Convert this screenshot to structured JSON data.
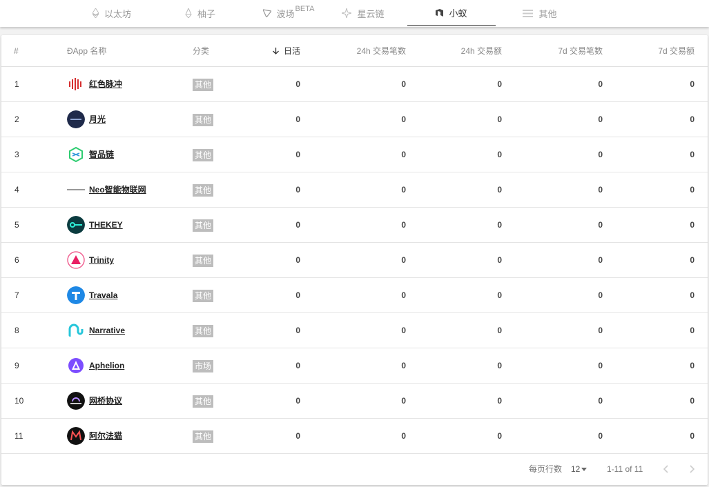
{
  "tabs": [
    {
      "label": "以太坊",
      "icon": "ethereum-icon"
    },
    {
      "label": "柚子",
      "icon": "eos-icon"
    },
    {
      "label": "波场",
      "beta": "BETA",
      "icon": "tron-icon"
    },
    {
      "label": "星云链",
      "icon": "nebulas-icon"
    },
    {
      "label": "小蚁",
      "icon": "neo-icon",
      "active": true
    },
    {
      "label": "其他",
      "icon": "menu-lines-icon"
    }
  ],
  "table": {
    "headers": {
      "rank": "#",
      "name": "ĐApp 名称",
      "category": "分类",
      "dau": "日活",
      "tx24": "24h 交易笔数",
      "vol24": "24h 交易额",
      "tx7d": "7d 交易笔数",
      "vol7d": "7d 交易额"
    },
    "sort_icon": "arrow-down-icon",
    "rows": [
      {
        "rank": "1",
        "name": "红色脉冲",
        "category": "其他",
        "dau": "0",
        "tx24": "0",
        "vol24": "0",
        "tx7d": "0",
        "vol7d": "0",
        "logo": "red-pulse-logo"
      },
      {
        "rank": "2",
        "name": "月光",
        "category": "其他",
        "dau": "0",
        "tx24": "0",
        "vol24": "0",
        "tx7d": "0",
        "vol7d": "0",
        "logo": "moonlight-logo"
      },
      {
        "rank": "3",
        "name": "智品链",
        "category": "其他",
        "dau": "0",
        "tx24": "0",
        "vol24": "0",
        "tx7d": "0",
        "vol7d": "0",
        "logo": "zhipin-logo"
      },
      {
        "rank": "4",
        "name": "Neo智能物联网",
        "category": "其他",
        "dau": "0",
        "tx24": "0",
        "vol24": "0",
        "tx7d": "0",
        "vol7d": "0",
        "logo": "neo-iot-logo"
      },
      {
        "rank": "5",
        "name": "THEKEY",
        "category": "其他",
        "dau": "0",
        "tx24": "0",
        "vol24": "0",
        "tx7d": "0",
        "vol7d": "0",
        "logo": "thekey-logo"
      },
      {
        "rank": "6",
        "name": "Trinity",
        "category": "其他",
        "dau": "0",
        "tx24": "0",
        "vol24": "0",
        "tx7d": "0",
        "vol7d": "0",
        "logo": "trinity-logo"
      },
      {
        "rank": "7",
        "name": "Travala",
        "category": "其他",
        "dau": "0",
        "tx24": "0",
        "vol24": "0",
        "tx7d": "0",
        "vol7d": "0",
        "logo": "travala-logo"
      },
      {
        "rank": "8",
        "name": "Narrative",
        "category": "其他",
        "dau": "0",
        "tx24": "0",
        "vol24": "0",
        "tx7d": "0",
        "vol7d": "0",
        "logo": "narrative-logo"
      },
      {
        "rank": "9",
        "name": "Aphelion",
        "category": "市场",
        "dau": "0",
        "tx24": "0",
        "vol24": "0",
        "tx7d": "0",
        "vol7d": "0",
        "logo": "aphelion-logo"
      },
      {
        "rank": "10",
        "name": "网桥协议",
        "category": "其他",
        "dau": "0",
        "tx24": "0",
        "vol24": "0",
        "tx7d": "0",
        "vol7d": "0",
        "logo": "bridge-protocol-logo"
      },
      {
        "rank": "11",
        "name": "阿尔法猫",
        "category": "其他",
        "dau": "0",
        "tx24": "0",
        "vol24": "0",
        "tx7d": "0",
        "vol7d": "0",
        "logo": "alphacat-logo"
      }
    ]
  },
  "pagination": {
    "rows_per_page_label": "每页行数",
    "rows_per_page_value": "12",
    "range": "1-11 of 11"
  },
  "colors": {
    "badge": "#bdbdbd",
    "active_tab_underline": "#888888"
  }
}
